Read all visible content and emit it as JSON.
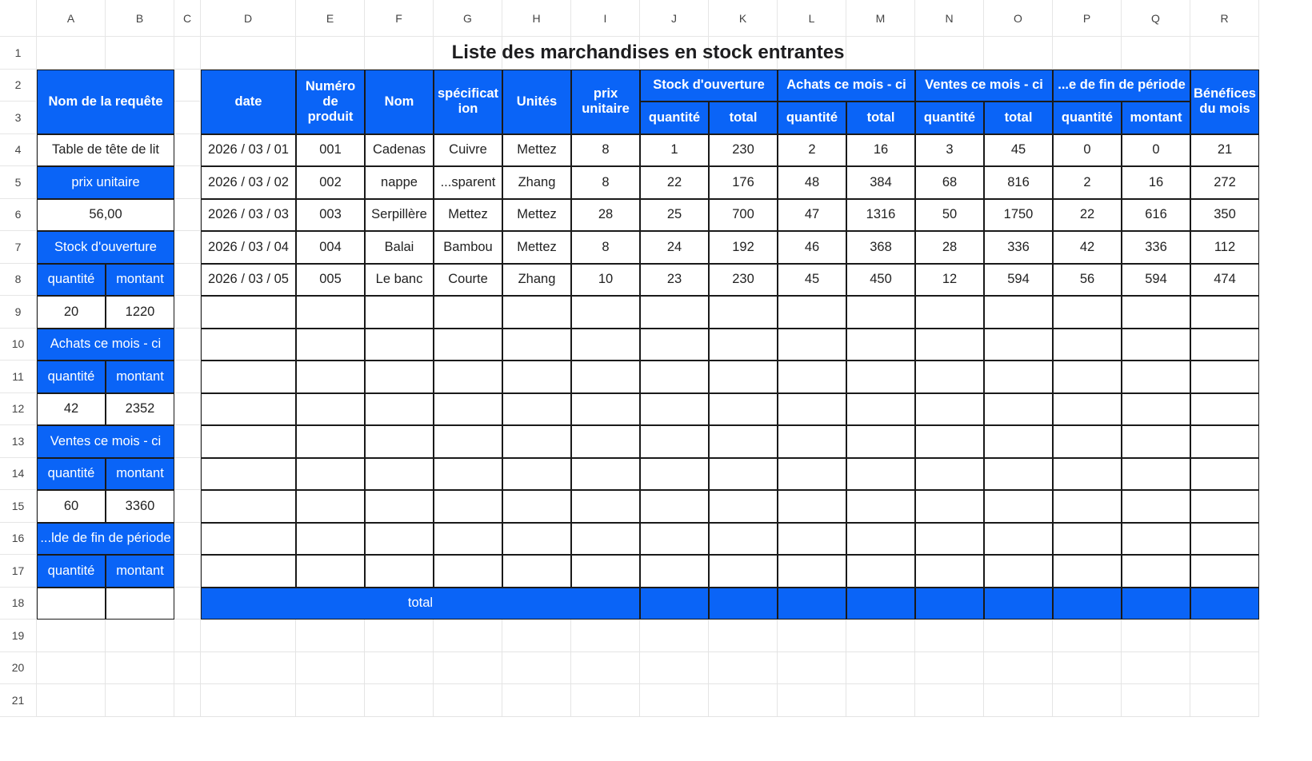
{
  "columns": [
    "A",
    "B",
    "C",
    "D",
    "E",
    "F",
    "G",
    "H",
    "I",
    "J",
    "K",
    "L",
    "M",
    "N",
    "O",
    "P",
    "Q",
    "R"
  ],
  "rows": [
    "1",
    "2",
    "3",
    "4",
    "5",
    "6",
    "7",
    "8",
    "9",
    "10",
    "11",
    "12",
    "13",
    "14",
    "15",
    "16",
    "17",
    "18",
    "19",
    "20",
    "21"
  ],
  "title": "Liste des marchandises en stock entrantes",
  "colors": {
    "accent": "#0a64f7",
    "border": "#1a1a1a"
  },
  "query": {
    "header": "Nom de la requête",
    "value": "Table de tête de lit",
    "unit_price_label": "prix unitaire",
    "unit_price_value": "56,00",
    "opening_label": "Stock d'ouverture",
    "qty_label": "quantité",
    "amount_label": "montant",
    "opening_qty": "20",
    "opening_amount": "1220",
    "purchases_label": "Achats ce mois - ci",
    "purchases_qty": "42",
    "purchases_amount": "2352",
    "sales_label": "Ventes ce mois - ci",
    "sales_qty": "60",
    "sales_amount": "3360",
    "closing_label": "...lde de fin de période"
  },
  "table": {
    "headers": {
      "date": "date",
      "product_number": "Numéro de produit",
      "name": "Nom",
      "spec": "spécificat ion",
      "units": "Unités",
      "unit_price": "prix unitaire",
      "opening": "Stock d'ouverture",
      "purchases": "Achats ce mois - ci",
      "sales": "Ventes ce mois - ci",
      "closing": "...e de fin de période",
      "profit": "Bénéfices du mois",
      "quantity": "quantité",
      "total": "total",
      "amount": "montant"
    },
    "rows": [
      [
        "2026 / 03 / 01",
        "001",
        "Cadenas",
        "Cuivre",
        "Mettez",
        "8",
        "1",
        "230",
        "2",
        "16",
        "3",
        "45",
        "0",
        "0",
        "21"
      ],
      [
        "2026 / 03 / 02",
        "002",
        "nappe",
        "...sparent",
        "Zhang",
        "8",
        "22",
        "176",
        "48",
        "384",
        "68",
        "816",
        "2",
        "16",
        "272"
      ],
      [
        "2026 / 03 / 03",
        "003",
        "Serpillère",
        "Mettez",
        "Mettez",
        "28",
        "25",
        "700",
        "47",
        "1316",
        "50",
        "1750",
        "22",
        "616",
        "350"
      ],
      [
        "2026 / 03 / 04",
        "004",
        "Balai",
        "Bambou",
        "Mettez",
        "8",
        "24",
        "192",
        "46",
        "368",
        "28",
        "336",
        "42",
        "336",
        "112"
      ],
      [
        "2026 / 03 / 05",
        "005",
        "Le banc",
        "Courte",
        "Zhang",
        "10",
        "23",
        "230",
        "45",
        "450",
        "12",
        "594",
        "56",
        "594",
        "474"
      ]
    ],
    "total_label": "total"
  }
}
